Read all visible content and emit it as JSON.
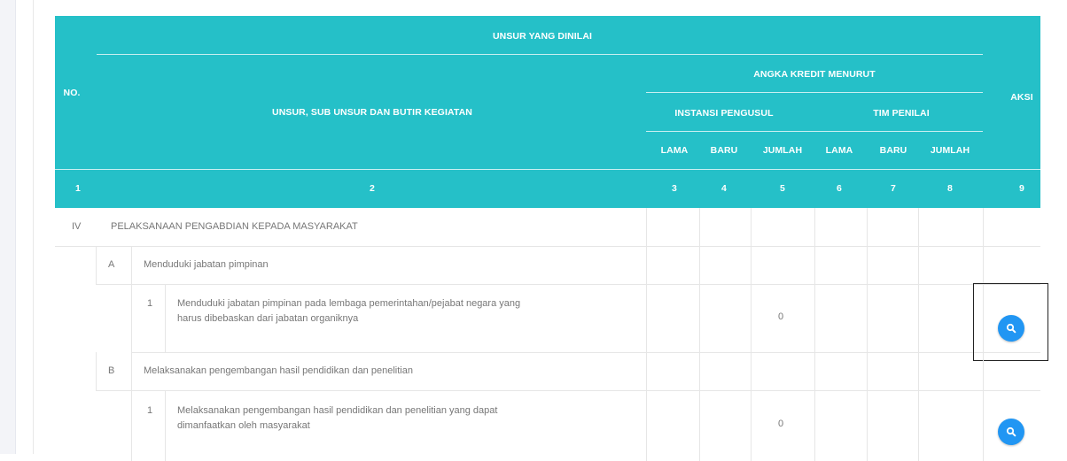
{
  "header": {
    "no": "NO.",
    "unsur_dinilai": "UNSUR YANG DINILAI",
    "unsur_sub": "UNSUR, SUB UNSUR DAN BUTIR KEGIATAN",
    "angka_kredit": "ANGKA KREDIT MENURUT",
    "instansi": "INSTANSI PENGUSUL",
    "tim": "TIM PENILAI",
    "aksi": "AKSI",
    "lama1": "LAMA",
    "baru1": "BARU",
    "jumlah1": "JUMLAH",
    "lama2": "LAMA",
    "baru2": "BARU",
    "jumlah2": "JUMLAH",
    "num": [
      "1",
      "2",
      "3",
      "4",
      "5",
      "6",
      "7",
      "8",
      "9"
    ]
  },
  "rows": {
    "section": {
      "no": "IV",
      "title": "PELAKSANAAN PENGABDIAN KEPADA MASYARAKAT"
    },
    "sub_a": {
      "letter": "A",
      "title": "Menduduki jabatan pimpinan"
    },
    "item_a1": {
      "num": "1",
      "line1": "Menduduki jabatan pimpinan pada lembaga pemerintahan/pejabat negara yang",
      "line2": "harus dibebaskan dari jabatan organiknya",
      "jumlah": "0"
    },
    "sub_b": {
      "letter": "B",
      "title": "Melaksanakan pengembangan hasil pendidikan dan penelitian"
    },
    "item_b1": {
      "num": "1",
      "line1": "Melaksanakan pengembangan hasil pendidikan dan penelitian yang dapat",
      "line2": "dimanfaatkan oleh masyarakat",
      "jumlah": "0"
    }
  },
  "colors": {
    "header_bg": "#25c0c8",
    "button_bg": "#2196f3"
  },
  "icons": {
    "view": "search-icon"
  }
}
